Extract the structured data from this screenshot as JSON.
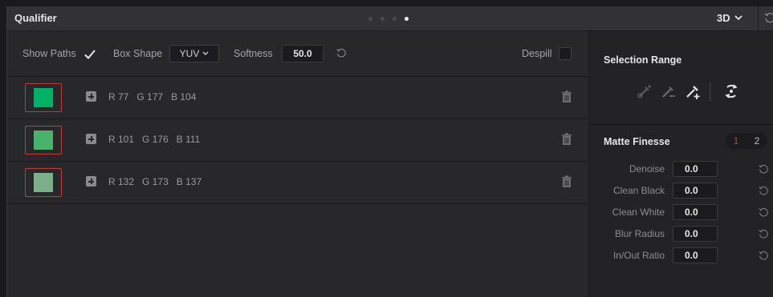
{
  "header": {
    "title": "Qualifier",
    "page_dots": 4,
    "active_dot": 4,
    "view_mode": "3D",
    "icons": [
      "chevron-down-icon",
      "reset-icon"
    ]
  },
  "options": {
    "show_paths_label": "Show Paths",
    "show_paths_checked": true,
    "box_shape_label": "Box Shape",
    "box_shape_value": "YUV",
    "softness_label": "Softness",
    "softness_value": "50.0",
    "despill_label": "Despill",
    "despill_checked": false
  },
  "colors": {
    "selected_border": "#c23b3b",
    "active_tab": "#d23a3a"
  },
  "samples": [
    {
      "r_label": "R 77",
      "g_label": "G 177",
      "b_label": "B 104",
      "color": "#00b166"
    },
    {
      "r_label": "R 101",
      "g_label": "G 176",
      "b_label": "B 111",
      "color": "#4ab26a"
    },
    {
      "r_label": "R 132",
      "g_label": "G 173",
      "b_label": "B 137",
      "color": "#7cae89"
    }
  ],
  "selection_range": {
    "title": "Selection Range",
    "tools": [
      "picker-icon",
      "picker-minus-icon",
      "picker-plus-icon",
      "invert-selection-icon"
    ],
    "active_tool": "picker-plus-icon"
  },
  "matte_finesse": {
    "title": "Matte Finesse",
    "tabs": [
      "1",
      "2"
    ],
    "active_tab": "1",
    "fields": [
      {
        "label": "Denoise",
        "value": "0.0"
      },
      {
        "label": "Clean Black",
        "value": "0.0"
      },
      {
        "label": "Clean White",
        "value": "0.0"
      },
      {
        "label": "Blur Radius",
        "value": "0.0"
      },
      {
        "label": "In/Out Ratio",
        "value": "0.0"
      }
    ]
  }
}
